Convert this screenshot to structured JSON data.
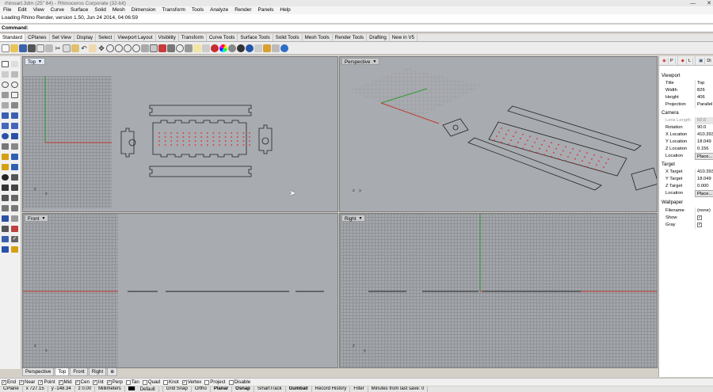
{
  "window": {
    "title": "rhinoart.3dm (25\" 64) - Rhinoceros Corporate (32-bit)",
    "minimize": "—",
    "close": "✕"
  },
  "menu": [
    "File",
    "Edit",
    "View",
    "Curve",
    "Surface",
    "Solid",
    "Mesh",
    "Dimension",
    "Transform",
    "Tools",
    "Analyze",
    "Render",
    "Panels",
    "Help"
  ],
  "history": "Loading Rhino Render, version 1.50, Jun 24 2014, 04:06:59",
  "command_label": "Command:",
  "toolbar_tabs": [
    "Standard",
    "CPlanes",
    "Set View",
    "Display",
    "Select",
    "Viewport Layout",
    "Visibility",
    "Transform",
    "Curve Tools",
    "Surface Tools",
    "Solid Tools",
    "Mesh Tools",
    "Render Tools",
    "Drafting",
    "New in V5"
  ],
  "active_tab": "Standard",
  "viewports": {
    "top": {
      "label": "Top"
    },
    "perspective": {
      "label": "Perspective"
    },
    "front": {
      "label": "Front"
    },
    "right": {
      "label": "Right"
    }
  },
  "axis": {
    "x": "x",
    "y": "y",
    "z": "z"
  },
  "view_tabs": [
    "Perspective",
    "Top",
    "Front",
    "Right",
    "⊕"
  ],
  "active_view_tab": "Top",
  "osnaps": [
    {
      "label": "End",
      "checked": true
    },
    {
      "label": "Near",
      "checked": true
    },
    {
      "label": "Point",
      "checked": true
    },
    {
      "label": "Mid",
      "checked": true
    },
    {
      "label": "Cen",
      "checked": true
    },
    {
      "label": "Int",
      "checked": true
    },
    {
      "label": "Perp",
      "checked": true
    },
    {
      "label": "Tan",
      "checked": false
    },
    {
      "label": "Quad",
      "checked": false
    },
    {
      "label": "Knot",
      "checked": false
    },
    {
      "label": "Vertex",
      "checked": true
    },
    {
      "label": "Project",
      "checked": false
    },
    {
      "label": "Disable",
      "checked": false
    }
  ],
  "status": {
    "cplane": "CPlane",
    "x": "x 727.15",
    "y": "y -148.34",
    "z": "z 0.00",
    "units": "Millimeters",
    "layer": "Default",
    "grid_snap": "Grid Snap",
    "ortho": "Ortho",
    "planar": "Planar",
    "osnap": "Osnap",
    "smarttrack": "SmartTrack",
    "gumball": "Gumball",
    "record_history": "Record History",
    "filter": "Filter",
    "last_save": "Minutes from last save: 0"
  },
  "properties_panel": {
    "tabs": [
      "P",
      "L",
      "Di"
    ],
    "viewport_section": "Viewport",
    "viewport_rows": [
      {
        "key": "Title",
        "value": "Top"
      },
      {
        "key": "Width",
        "value": "826"
      },
      {
        "key": "Height",
        "value": "406"
      },
      {
        "key": "Projection",
        "value": "Parallel"
      }
    ],
    "camera_section": "Camera",
    "camera_rows": [
      {
        "key": "Lens Length",
        "value": "50.0",
        "disabled": true
      },
      {
        "key": "Rotation",
        "value": "90.0"
      },
      {
        "key": "X Location",
        "value": "410.393"
      },
      {
        "key": "Y Location",
        "value": "18.049"
      },
      {
        "key": "Z Location",
        "value": "0.156"
      },
      {
        "key": "Location",
        "value": "Place...",
        "button": true
      }
    ],
    "target_section": "Target",
    "target_rows": [
      {
        "key": "X Target",
        "value": "410.393"
      },
      {
        "key": "Y Target",
        "value": "18.049"
      },
      {
        "key": "Z Target",
        "value": "0.000"
      },
      {
        "key": "Location",
        "value": "Place...",
        "button": true
      }
    ],
    "wallpaper_section": "Wallpaper",
    "wallpaper_rows": [
      {
        "key": "Filename",
        "value": "(none)"
      },
      {
        "key": "Show",
        "value": "✓"
      },
      {
        "key": "Gray",
        "value": "✓"
      }
    ]
  },
  "colors": {
    "viewport_bg": "#a8abb0",
    "x_axis": "#c0392b",
    "y_axis": "#2e9b2e",
    "dots": "#e03030"
  }
}
